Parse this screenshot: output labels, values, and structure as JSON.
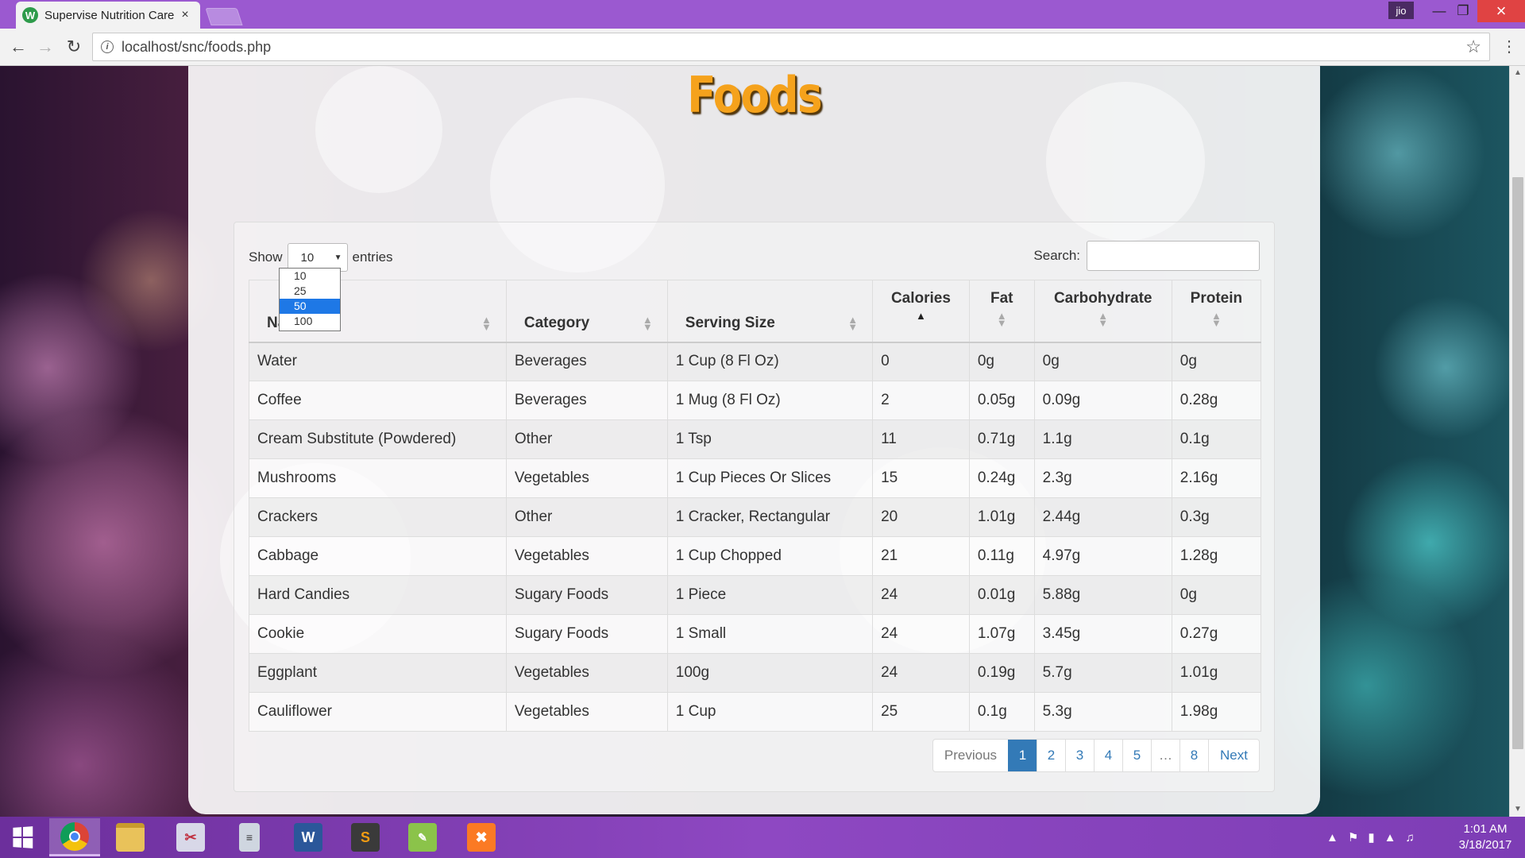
{
  "browser": {
    "tab_title": "Supervise Nutrition Care",
    "tab_close": "×",
    "url": "localhost/snc/foods.php",
    "profile_name": "jio",
    "back_icon": "←",
    "forward_icon": "→",
    "reload_icon": "↻",
    "star_icon": "☆",
    "menu_icon": "⋮"
  },
  "page": {
    "title": "Foods",
    "show_label": "Show",
    "entries_label": "entries",
    "length_value": "10",
    "length_options": [
      "10",
      "25",
      "50",
      "100"
    ],
    "length_highlighted": "50",
    "search_label": "Search:",
    "search_value": ""
  },
  "table": {
    "columns": [
      {
        "label": "Name",
        "visible_label": "Na"
      },
      {
        "label": "Category"
      },
      {
        "label": "Serving Size"
      },
      {
        "label": "Calories",
        "sort": "ascending"
      },
      {
        "label": "Fat"
      },
      {
        "label": "Carbohydrate"
      },
      {
        "label": "Protein"
      }
    ],
    "rows": [
      [
        "Water",
        "Beverages",
        "1 Cup (8 Fl Oz)",
        "0",
        "0g",
        "0g",
        "0g"
      ],
      [
        "Coffee",
        "Beverages",
        "1 Mug (8 Fl Oz)",
        "2",
        "0.05g",
        "0.09g",
        "0.28g"
      ],
      [
        "Cream Substitute (Powdered)",
        "Other",
        "1 Tsp",
        "11",
        "0.71g",
        "1.1g",
        "0.1g"
      ],
      [
        "Mushrooms",
        "Vegetables",
        "1 Cup Pieces Or Slices",
        "15",
        "0.24g",
        "2.3g",
        "2.16g"
      ],
      [
        "Crackers",
        "Other",
        "1 Cracker, Rectangular",
        "20",
        "1.01g",
        "2.44g",
        "0.3g"
      ],
      [
        "Cabbage",
        "Vegetables",
        "1 Cup Chopped",
        "21",
        "0.11g",
        "4.97g",
        "1.28g"
      ],
      [
        "Hard Candies",
        "Sugary Foods",
        "1 Piece",
        "24",
        "0.01g",
        "5.88g",
        "0g"
      ],
      [
        "Cookie",
        "Sugary Foods",
        "1 Small",
        "24",
        "1.07g",
        "3.45g",
        "0.27g"
      ],
      [
        "Eggplant",
        "Vegetables",
        "100g",
        "24",
        "0.19g",
        "5.7g",
        "1.01g"
      ],
      [
        "Cauliflower",
        "Vegetables",
        "1 Cup",
        "25",
        "0.1g",
        "5.3g",
        "1.98g"
      ]
    ]
  },
  "pagination": {
    "previous": "Previous",
    "pages": [
      "1",
      "2",
      "3",
      "4",
      "5",
      "…",
      "8"
    ],
    "active_page": "1",
    "next": "Next"
  },
  "taskbar": {
    "apps": [
      "chrome-icon",
      "file-explorer-icon",
      "snipping-tool-icon",
      "calculator-icon",
      "word-icon",
      "sublime-text-icon",
      "notepad-icon",
      "xampp-icon"
    ],
    "time": "1:01 AM",
    "date": "3/18/2017"
  }
}
